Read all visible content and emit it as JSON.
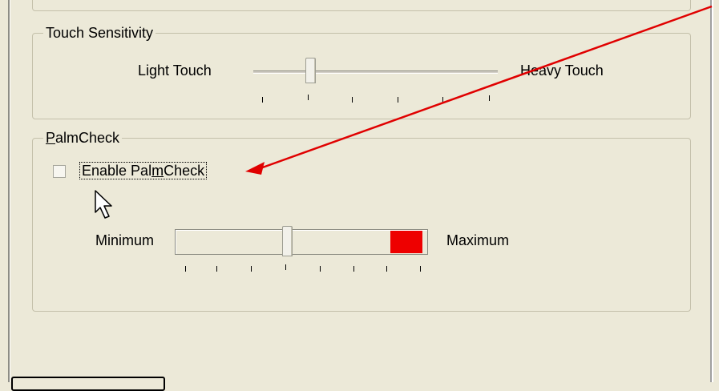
{
  "touch_sensitivity": {
    "legend": "Touch Sensitivity",
    "min_label": "Light Touch",
    "max_label": "Heavy Touch",
    "position": 1,
    "tick_count": 6
  },
  "palmcheck": {
    "legend_accel": "P",
    "legend_rest": "almCheck",
    "checkbox": {
      "label_pre": "Enable Pal",
      "label_accel": "m",
      "label_post": "Check",
      "checked": false
    },
    "min_label": "Minimum",
    "max_label": "Maximum",
    "position": 3,
    "tick_count": 8,
    "range_color": "#ee0000"
  },
  "annotation": {
    "arrow_color": "#e00000"
  },
  "icons": [
    "mouse-cursor-icon",
    "red-arrow-icon"
  ]
}
